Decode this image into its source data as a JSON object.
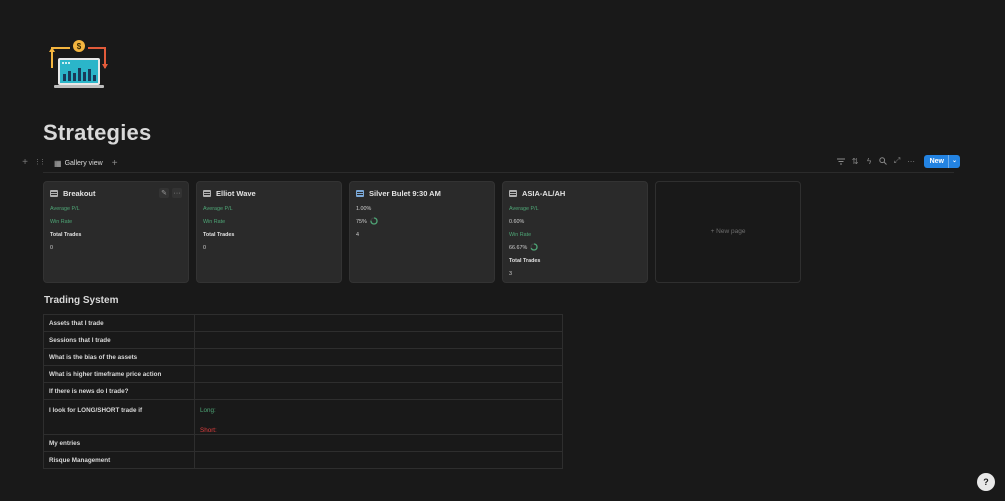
{
  "page": {
    "title": "Strategies",
    "icon": "trading-chart-icon"
  },
  "database": {
    "toolbar": {
      "add_glyph": "+",
      "drag_glyph": "⋮⋮",
      "view_tab_label": "Gallery view",
      "add_view_glyph": "+",
      "tools": [
        "filter-icon",
        "sort-icon",
        "lightning-icon",
        "search-icon",
        "expand-icon",
        "more-icon"
      ],
      "new_label": "New",
      "new_dropdown_glyph": "⌄"
    },
    "cards": [
      {
        "title": "Breakout",
        "icon": "card-icon",
        "properties": [
          {
            "text": "Average P/L",
            "style": "green"
          },
          {
            "text": "Win Rate",
            "style": "green"
          },
          {
            "text": "Total Trades",
            "style": "white"
          },
          {
            "text": "0",
            "style": "val"
          }
        ],
        "hover_actions": [
          "edit-icon",
          "more-icon"
        ]
      },
      {
        "title": "Elliot Wave",
        "icon": "card-icon",
        "properties": [
          {
            "text": "Average P/L",
            "style": "green"
          },
          {
            "text": "Win Rate",
            "style": "green"
          },
          {
            "text": "Total Trades",
            "style": "white"
          },
          {
            "text": "0",
            "style": "val"
          }
        ]
      },
      {
        "title": "Silver Bulet 9:30 AM",
        "icon": "image-icon",
        "properties": [
          {
            "text": "1.00%",
            "style": "val"
          },
          {
            "text": "75%",
            "style": "val",
            "ring": 0.75
          },
          {
            "text": "4",
            "style": "val"
          }
        ]
      },
      {
        "title": "ASIA-AL/AH",
        "icon": "card-icon",
        "properties": [
          {
            "text": "Average P/L",
            "style": "green"
          },
          {
            "text": "0.60%",
            "style": "val"
          },
          {
            "text": "Win Rate",
            "style": "green"
          },
          {
            "text": "66.67%",
            "style": "val",
            "ring": 0.6667
          },
          {
            "text": "Total Trades",
            "style": "white"
          },
          {
            "text": "3",
            "style": "val"
          }
        ]
      }
    ],
    "new_page_label": "+ New page"
  },
  "trading_system": {
    "title": "Trading System",
    "rows": [
      {
        "label": "Assets that I trade",
        "value": ""
      },
      {
        "label": "Sessions that I trade",
        "value": ""
      },
      {
        "label": "What is the bias of the assets",
        "value": ""
      },
      {
        "label": "What is higher timeframe price action",
        "value": ""
      },
      {
        "label": "If there is news do I trade?",
        "value": ""
      },
      {
        "label": "I look for LONG/SHORT trade if",
        "long": "Long:",
        "short": "Short:"
      },
      {
        "label": "My entries",
        "value": ""
      },
      {
        "label": "Risque Management",
        "value": ""
      }
    ]
  },
  "help": {
    "label": "?"
  },
  "colors": {
    "background": "#191919",
    "card": "#2a2a2a",
    "accent": "#2383e2",
    "green": "#4ea676",
    "red": "#e03e3e"
  }
}
